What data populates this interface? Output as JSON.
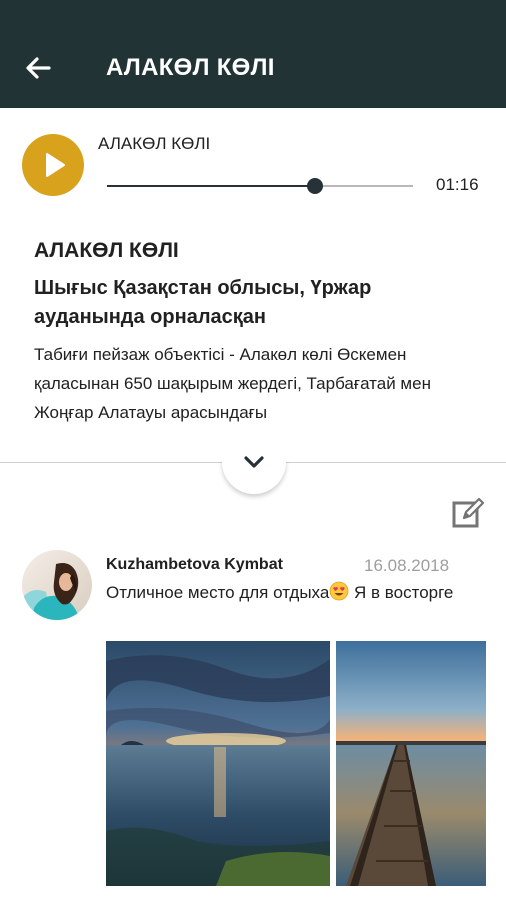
{
  "header": {
    "title": "АЛАКӨЛ КӨЛІ",
    "back_icon": "arrow-left-icon"
  },
  "player": {
    "track_title": "АЛАКӨЛ КӨЛІ",
    "time": "01:16",
    "progress": 0.68,
    "play_icon": "play-icon",
    "accent_color": "#d8a21d"
  },
  "description": {
    "title": "АЛАКӨЛ КӨЛІ",
    "subtitle": "Шығыс Қазақстан облысы, Үржар ауданында орналасқан",
    "body": "Табиғи пейзаж объектісі - Алакөл көлі Өскемен қаласынан 650 шақырым жердегі, Тарбағатай мен Жоңғар Алатауы арасындағы",
    "expand_icon": "chevron-down-icon"
  },
  "comments": {
    "edit_icon": "edit-icon",
    "items": [
      {
        "author": "Kuzhambetova Kymbat",
        "date": "16.08.2018",
        "text_before_emoji": "Отличное место для отдыха",
        "text_after_emoji": " Я в восторге",
        "emoji_icon": "smiling-face-with-heart-eyes-icon"
      }
    ]
  },
  "colors": {
    "header_bg": "#223336",
    "accent": "#d8a21d"
  }
}
